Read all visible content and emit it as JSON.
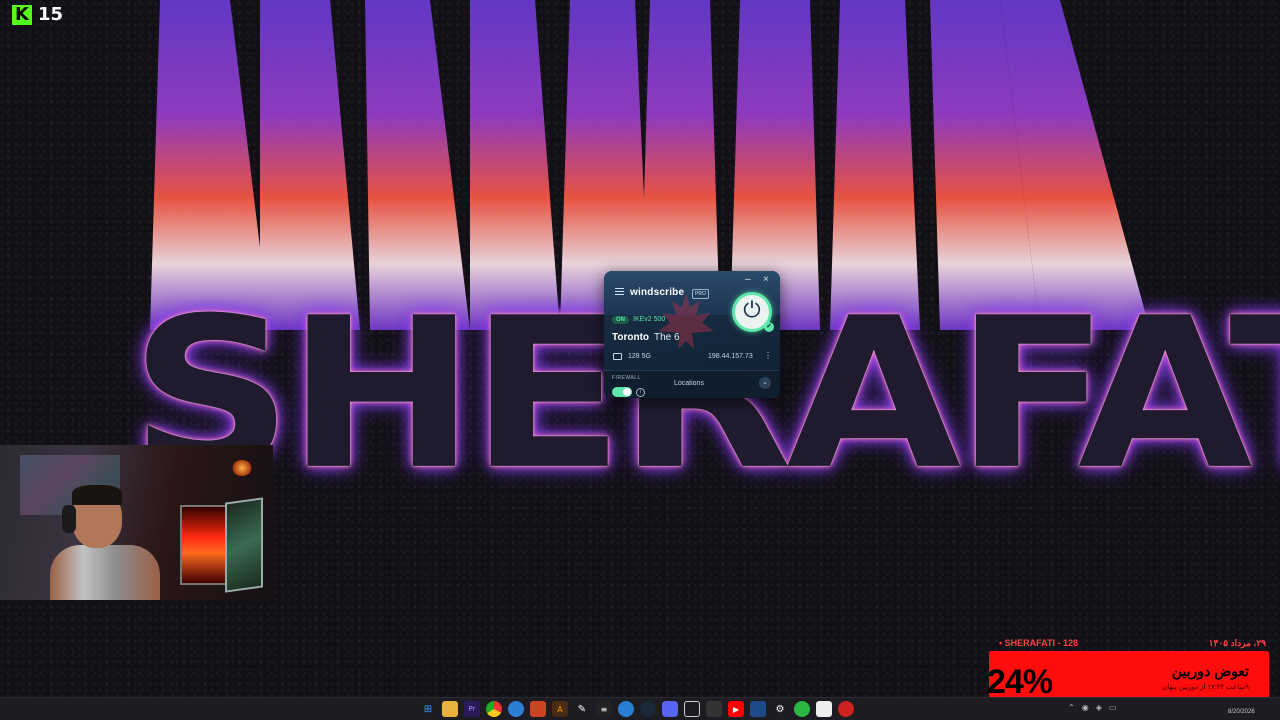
{
  "wallpaper": {
    "word": "SHERAFATI"
  },
  "kick": {
    "icon": "kick-logo-icon",
    "count": "15",
    "accent": "#53fc18"
  },
  "windscribe": {
    "app_name": "windscribe",
    "plan_badge": "PRO",
    "status": "ON",
    "protocol": "IKEv2 500",
    "city": "Toronto",
    "nickname": "The 6",
    "data_left": "128 5G",
    "ip": "198.44.157.73",
    "firewall_label": "FIREWALL",
    "locations_label": "Locations",
    "accent": "#5ce7a8"
  },
  "widget": {
    "streamer": "• SHERAFATI - 128",
    "date": "۲۹، مرداد ۱۴۰۵",
    "percent": "24%",
    "title": "تعوض دوربین",
    "subtitle": "۹ساعت ۱۷:۲۲ از دوربین پنهان",
    "accent": "#ff0d0d"
  },
  "taskbar": {
    "icons": [
      "windows-start-icon",
      "file-explorer-icon",
      "premiere-icon",
      "chrome-icon",
      "browser-icon",
      "app-red-icon",
      "illustrator-icon",
      "pen-icon",
      "terminal-icon",
      "cloud-icon",
      "steam-icon",
      "discord-icon",
      "window-icon",
      "app-dark-icon",
      "youtube-icon",
      "vscode-icon",
      "settings-icon",
      "whatsapp-icon",
      "notepad-icon",
      "windscribe-icon"
    ],
    "date": "8/20/2026"
  }
}
